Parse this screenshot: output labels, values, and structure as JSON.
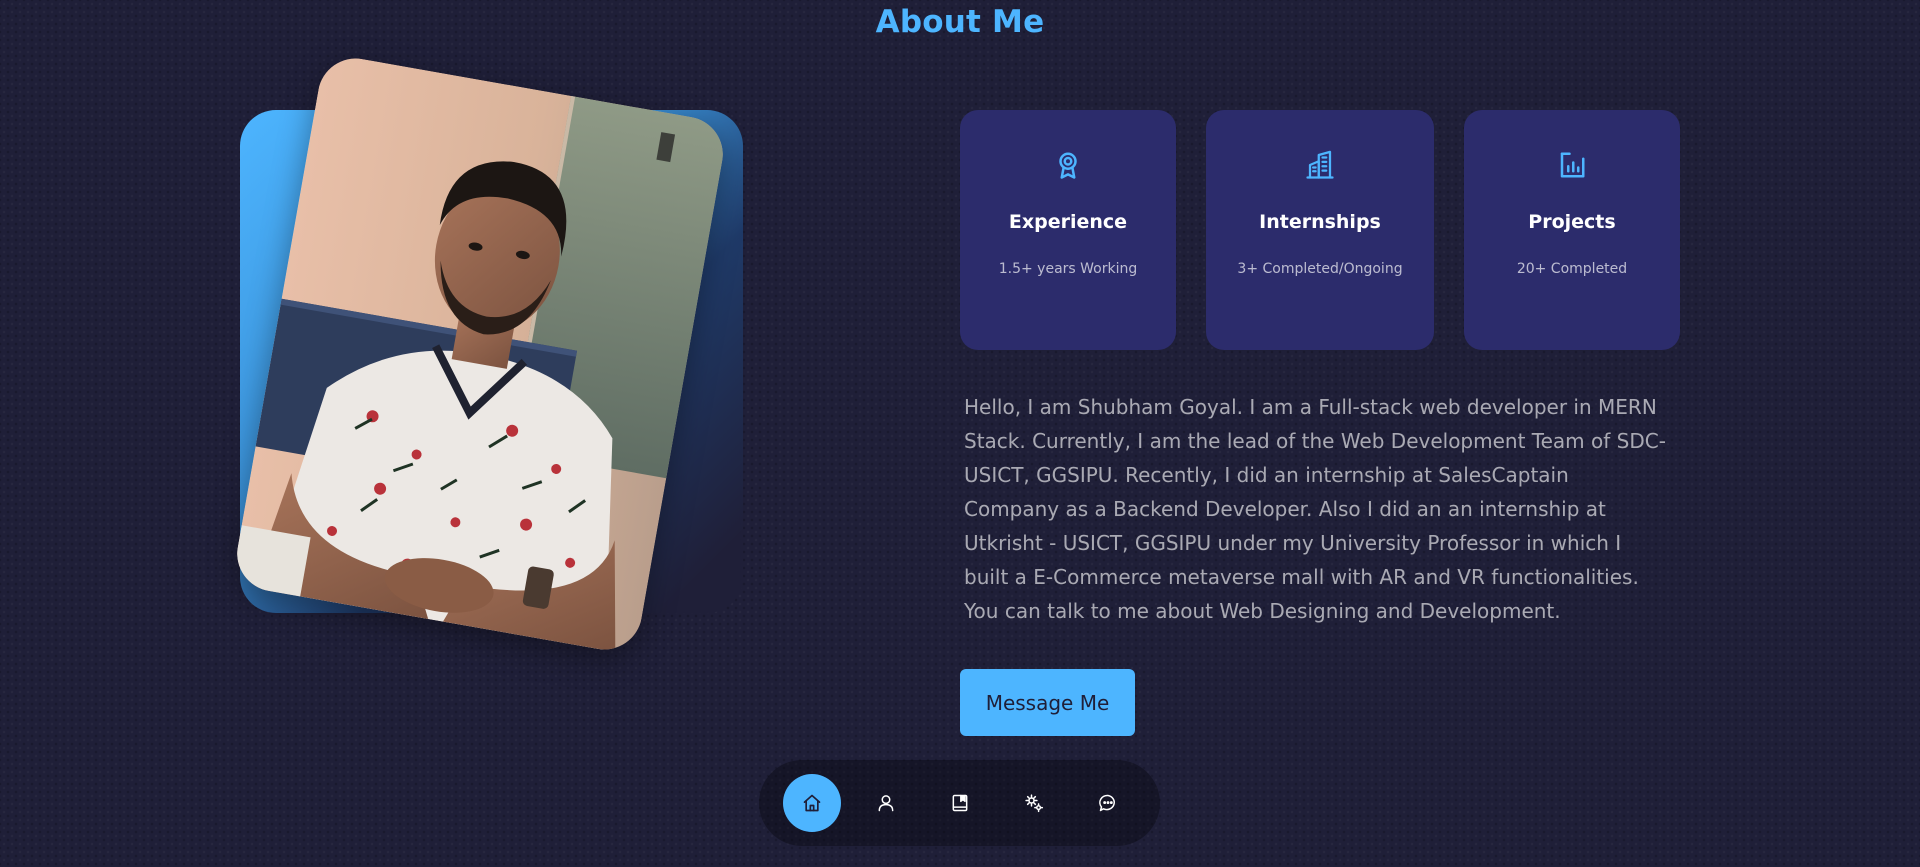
{
  "section": {
    "title": "About Me"
  },
  "photo": {
    "icon": "portrait-photo"
  },
  "cards": [
    {
      "icon": "award-icon",
      "title": "Experience",
      "subtitle": "1.5+ years Working"
    },
    {
      "icon": "building-icon",
      "title": "Internships",
      "subtitle": "3+ Completed/Ongoing"
    },
    {
      "icon": "chart-icon",
      "title": "Projects",
      "subtitle": "20+ Completed"
    }
  ],
  "bio": "Hello, I am Shubham Goyal. I am a Full-stack web developer in MERN Stack. Currently, I am the lead of the Web Development Team of SDC-USICT, GGSIPU. Recently, I did an internship at SalesCaptain Company as a Backend Developer. Also I did an an internship at Utkrisht - USICT, GGSIPU under my University Professor in which I built a E-Commerce metaverse mall with AR and VR functionalities. You can talk to me about Web Designing and Development.",
  "cta": {
    "label": "Message Me"
  },
  "nav": {
    "items": [
      {
        "icon": "home-icon",
        "active": true
      },
      {
        "icon": "user-icon",
        "active": false
      },
      {
        "icon": "book-icon",
        "active": false
      },
      {
        "icon": "gears-icon",
        "active": false
      },
      {
        "icon": "chat-icon",
        "active": false
      }
    ]
  },
  "colors": {
    "background": "#1f1f38",
    "primary": "#4db5ff",
    "card": "#2c2c6c",
    "text_light": "rgba(255,255,255,0.6)"
  }
}
